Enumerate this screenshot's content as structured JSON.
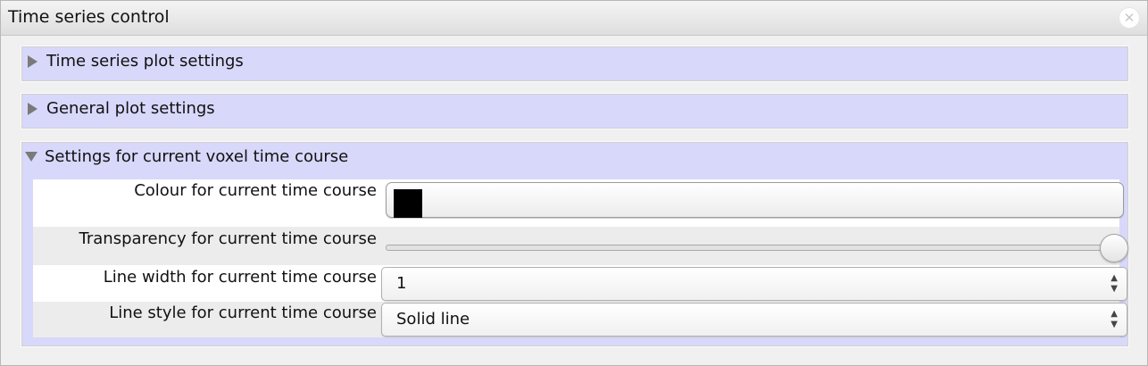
{
  "window": {
    "title": "Time series control",
    "close_icon": "close-icon"
  },
  "sections": [
    {
      "label": "Time series plot settings",
      "expanded": false
    },
    {
      "label": "General plot settings",
      "expanded": false
    },
    {
      "label": "Settings for current voxel time course",
      "expanded": true
    }
  ],
  "settings": {
    "colour": {
      "label": "Colour for current time course",
      "value_color": "#000000"
    },
    "transparency": {
      "label": "Transparency for current time course",
      "value_fraction": 1.0
    },
    "line_width": {
      "label": "Line width for current time course",
      "value": "1"
    },
    "line_style": {
      "label": "Line style for current time course",
      "value": "Solid line"
    }
  },
  "colors": {
    "section_bg": "#d8d8fb",
    "row_bg_white": "#ffffff",
    "row_bg_gray": "#ececec"
  }
}
